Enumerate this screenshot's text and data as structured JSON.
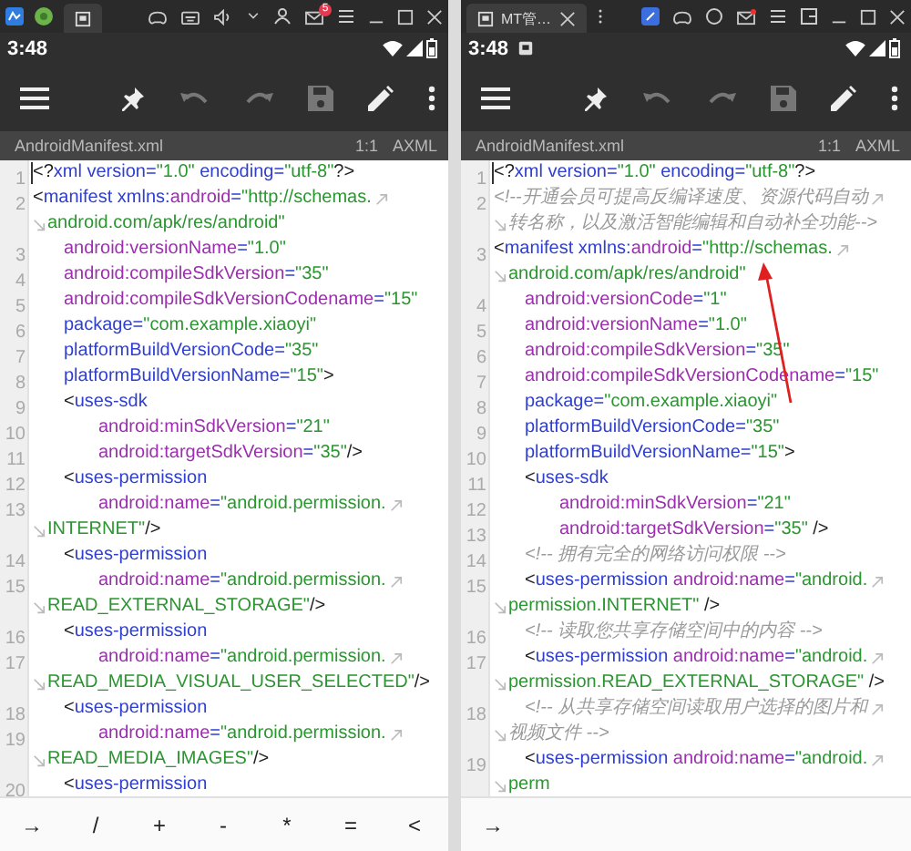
{
  "panels": [
    {
      "host_bar": {
        "badge": "5"
      },
      "status_bar": {
        "time": "3:48"
      },
      "file_bar": {
        "file_name": "AndroidManifest.xml",
        "position": "1:1",
        "mode": "AXML"
      },
      "code_lines": [
        {
          "number": "1",
          "kind": "root",
          "tokens": [
            {
              "kind": "punct",
              "text": "<?"
            },
            {
              "kind": "tag",
              "text": "xml"
            },
            {
              "kind": "attr",
              "text": " version="
            },
            {
              "kind": "value",
              "text": "\"1.0\""
            },
            {
              "kind": "attr",
              "text": " encoding="
            },
            {
              "kind": "value",
              "text": "\"utf-8\""
            },
            {
              "kind": "punct",
              "text": "?>"
            }
          ]
        },
        {
          "number": "2",
          "kind": "root",
          "wrapped": true,
          "tokens": [
            {
              "kind": "punct",
              "text": "<"
            },
            {
              "kind": "tag",
              "text": "manifest"
            },
            {
              "kind": "attr",
              "text": " xmlns:"
            },
            {
              "kind": "ns",
              "text": "android"
            },
            {
              "kind": "attr",
              "text": "="
            },
            {
              "kind": "value",
              "text": "\"http://schemas."
            }
          ]
        },
        {
          "kind": "wrap",
          "tokens": [
            {
              "kind": "value",
              "text": "android.com/apk/res/android\""
            }
          ]
        },
        {
          "number": "3",
          "kind": "inner",
          "tokens": [
            {
              "kind": "ns",
              "text": "android:versionName"
            },
            {
              "kind": "attr",
              "text": "="
            },
            {
              "kind": "value",
              "text": "\"1.0\""
            }
          ]
        },
        {
          "number": "4",
          "kind": "inner",
          "tokens": [
            {
              "kind": "ns",
              "text": "android:compileSdkVersion"
            },
            {
              "kind": "attr",
              "text": "="
            },
            {
              "kind": "value",
              "text": "\"35\""
            }
          ]
        },
        {
          "number": "5",
          "kind": "inner",
          "tokens": [
            {
              "kind": "ns",
              "text": "android:compileSdkVersionCodename"
            },
            {
              "kind": "attr",
              "text": "="
            },
            {
              "kind": "value",
              "text": "\"15\""
            }
          ]
        },
        {
          "number": "6",
          "kind": "inner",
          "tokens": [
            {
              "kind": "attr",
              "text": "package="
            },
            {
              "kind": "value",
              "text": "\"com.example.xiaoyi\""
            }
          ]
        },
        {
          "number": "7",
          "kind": "inner",
          "tokens": [
            {
              "kind": "attr",
              "text": "platformBuildVersionCode="
            },
            {
              "kind": "value",
              "text": "\"35\""
            }
          ]
        },
        {
          "number": "8",
          "kind": "inner",
          "tokens": [
            {
              "kind": "attr",
              "text": "platformBuildVersionName="
            },
            {
              "kind": "value",
              "text": "\"15\""
            },
            {
              "kind": "punct",
              "text": ">"
            }
          ]
        },
        {
          "number": "9",
          "kind": "inner",
          "tokens": [
            {
              "kind": "punct",
              "text": "<"
            },
            {
              "kind": "tag",
              "text": "uses-sdk"
            }
          ]
        },
        {
          "number": "10",
          "kind": "deep",
          "tokens": [
            {
              "kind": "ns",
              "text": "android:minSdkVersion"
            },
            {
              "kind": "attr",
              "text": "="
            },
            {
              "kind": "value",
              "text": "\"21\""
            }
          ]
        },
        {
          "number": "11",
          "kind": "deep",
          "tokens": [
            {
              "kind": "ns",
              "text": "android:targetSdkVersion"
            },
            {
              "kind": "attr",
              "text": "="
            },
            {
              "kind": "value",
              "text": "\"35\""
            },
            {
              "kind": "punct",
              "text": "/>"
            }
          ]
        },
        {
          "number": "12",
          "kind": "inner",
          "tokens": [
            {
              "kind": "punct",
              "text": "<"
            },
            {
              "kind": "tag",
              "text": "uses-permission"
            }
          ]
        },
        {
          "number": "13",
          "kind": "deep",
          "wrapped": true,
          "tokens": [
            {
              "kind": "ns",
              "text": "android:name"
            },
            {
              "kind": "attr",
              "text": "="
            },
            {
              "kind": "value",
              "text": "\"android.permission."
            }
          ]
        },
        {
          "kind": "wrap",
          "tokens": [
            {
              "kind": "value",
              "text": "INTERNET\""
            },
            {
              "kind": "punct",
              "text": "/>"
            }
          ]
        },
        {
          "number": "14",
          "kind": "inner",
          "tokens": [
            {
              "kind": "punct",
              "text": "<"
            },
            {
              "kind": "tag",
              "text": "uses-permission"
            }
          ]
        },
        {
          "number": "15",
          "kind": "deep",
          "wrapped": true,
          "tokens": [
            {
              "kind": "ns",
              "text": "android:name"
            },
            {
              "kind": "attr",
              "text": "="
            },
            {
              "kind": "value",
              "text": "\"android.permission."
            }
          ]
        },
        {
          "kind": "wrap",
          "tokens": [
            {
              "kind": "value",
              "text": "READ_EXTERNAL_STORAGE\""
            },
            {
              "kind": "punct",
              "text": "/>"
            }
          ]
        },
        {
          "number": "16",
          "kind": "inner",
          "tokens": [
            {
              "kind": "punct",
              "text": "<"
            },
            {
              "kind": "tag",
              "text": "uses-permission"
            }
          ]
        },
        {
          "number": "17",
          "kind": "deep",
          "wrapped": true,
          "tokens": [
            {
              "kind": "ns",
              "text": "android:name"
            },
            {
              "kind": "attr",
              "text": "="
            },
            {
              "kind": "value",
              "text": "\"android.permission."
            }
          ]
        },
        {
          "kind": "wrap",
          "tokens": [
            {
              "kind": "value",
              "text": "READ_MEDIA_VISUAL_USER_SELECTED\""
            },
            {
              "kind": "punct",
              "text": "/>"
            }
          ]
        },
        {
          "number": "18",
          "kind": "inner",
          "tokens": [
            {
              "kind": "punct",
              "text": "<"
            },
            {
              "kind": "tag",
              "text": "uses-permission"
            }
          ]
        },
        {
          "number": "19",
          "kind": "deep",
          "wrapped": true,
          "tokens": [
            {
              "kind": "ns",
              "text": "android:name"
            },
            {
              "kind": "attr",
              "text": "="
            },
            {
              "kind": "value",
              "text": "\"android.permission."
            }
          ]
        },
        {
          "kind": "wrap",
          "tokens": [
            {
              "kind": "value",
              "text": "READ_MEDIA_IMAGES\""
            },
            {
              "kind": "punct",
              "text": "/>"
            }
          ]
        },
        {
          "number": "20",
          "kind": "inner",
          "tokens": [
            {
              "kind": "punct",
              "text": "<"
            },
            {
              "kind": "tag",
              "text": "uses-permission"
            }
          ]
        }
      ],
      "keys": [
        "→",
        "/",
        "+",
        "-",
        "*",
        "=",
        "<"
      ]
    },
    {
      "host_bar": {
        "tab_title": "MT管…"
      },
      "status_bar": {
        "time": "3:48"
      },
      "file_bar": {
        "file_name": "AndroidManifest.xml",
        "position": "1:1",
        "mode": "AXML"
      },
      "code_lines": [
        {
          "number": "1",
          "kind": "root",
          "tokens": [
            {
              "kind": "punct",
              "text": "<?"
            },
            {
              "kind": "tag",
              "text": "xml"
            },
            {
              "kind": "attr",
              "text": " version="
            },
            {
              "kind": "value",
              "text": "\"1.0\""
            },
            {
              "kind": "attr",
              "text": " encoding="
            },
            {
              "kind": "value",
              "text": "\"utf-8\""
            },
            {
              "kind": "punct",
              "text": "?>"
            }
          ]
        },
        {
          "number": "2",
          "kind": "root",
          "wrapped": true,
          "tokens": [
            {
              "kind": "comment",
              "text": "<!--开通会员可提高反编译速度、资源代码自动"
            }
          ]
        },
        {
          "kind": "wrap",
          "tokens": [
            {
              "kind": "comment",
              "text": "转名称，以及激活智能编辑和自动补全功能-->"
            }
          ]
        },
        {
          "number": "3",
          "kind": "root",
          "wrapped": true,
          "tokens": [
            {
              "kind": "punct",
              "text": "<"
            },
            {
              "kind": "tag",
              "text": "manifest"
            },
            {
              "kind": "attr",
              "text": " xmlns:"
            },
            {
              "kind": "ns",
              "text": "android"
            },
            {
              "kind": "attr",
              "text": "="
            },
            {
              "kind": "value",
              "text": "\"http://schemas."
            }
          ]
        },
        {
          "kind": "wrap",
          "tokens": [
            {
              "kind": "value",
              "text": "android.com/apk/res/android\""
            }
          ]
        },
        {
          "number": "4",
          "kind": "inner",
          "tokens": [
            {
              "kind": "ns",
              "text": "android:versionCode"
            },
            {
              "kind": "attr",
              "text": "="
            },
            {
              "kind": "value",
              "text": "\"1\""
            }
          ]
        },
        {
          "number": "5",
          "kind": "inner",
          "tokens": [
            {
              "kind": "ns",
              "text": "android:versionName"
            },
            {
              "kind": "attr",
              "text": "="
            },
            {
              "kind": "value",
              "text": "\"1.0\""
            }
          ]
        },
        {
          "number": "6",
          "kind": "inner",
          "tokens": [
            {
              "kind": "ns",
              "text": "android:compileSdkVersion"
            },
            {
              "kind": "attr",
              "text": "="
            },
            {
              "kind": "value",
              "text": "\"35\""
            }
          ]
        },
        {
          "number": "7",
          "kind": "inner",
          "tokens": [
            {
              "kind": "ns",
              "text": "android:compileSdkVersionCodename"
            },
            {
              "kind": "attr",
              "text": "="
            },
            {
              "kind": "value",
              "text": "\"15\""
            }
          ]
        },
        {
          "number": "8",
          "kind": "inner",
          "tokens": [
            {
              "kind": "attr",
              "text": "package="
            },
            {
              "kind": "value",
              "text": "\"com.example.xiaoyi\""
            }
          ]
        },
        {
          "number": "9",
          "kind": "inner",
          "tokens": [
            {
              "kind": "attr",
              "text": "platformBuildVersionCode="
            },
            {
              "kind": "value",
              "text": "\"35\""
            }
          ]
        },
        {
          "number": "10",
          "kind": "inner",
          "tokens": [
            {
              "kind": "attr",
              "text": "platformBuildVersionName="
            },
            {
              "kind": "value",
              "text": "\"15\""
            },
            {
              "kind": "punct",
              "text": ">"
            }
          ]
        },
        {
          "number": "11",
          "kind": "inner",
          "tokens": [
            {
              "kind": "punct",
              "text": "<"
            },
            {
              "kind": "tag",
              "text": "uses-sdk"
            }
          ]
        },
        {
          "number": "12",
          "kind": "deep",
          "tokens": [
            {
              "kind": "ns",
              "text": "android:minSdkVersion"
            },
            {
              "kind": "attr",
              "text": "="
            },
            {
              "kind": "value",
              "text": "\"21\""
            }
          ]
        },
        {
          "number": "13",
          "kind": "deep",
          "tokens": [
            {
              "kind": "ns",
              "text": "android:targetSdkVersion"
            },
            {
              "kind": "attr",
              "text": "="
            },
            {
              "kind": "value",
              "text": "\"35\""
            },
            {
              "kind": "punct",
              "text": " />"
            }
          ]
        },
        {
          "number": "14",
          "kind": "inner",
          "tokens": [
            {
              "kind": "comment",
              "text": "<!-- 拥有完全的网络访问权限 -->"
            }
          ]
        },
        {
          "number": "15",
          "kind": "inner",
          "wrapped": true,
          "tokens": [
            {
              "kind": "punct",
              "text": "<"
            },
            {
              "kind": "tag",
              "text": "uses-permission"
            },
            {
              "kind": "ns",
              "text": " android:name"
            },
            {
              "kind": "attr",
              "text": "="
            },
            {
              "kind": "value",
              "text": "\"android."
            }
          ]
        },
        {
          "kind": "wrap",
          "tokens": [
            {
              "kind": "value",
              "text": "permission.INTERNET\""
            },
            {
              "kind": "punct",
              "text": " />"
            }
          ]
        },
        {
          "number": "16",
          "kind": "inner",
          "tokens": [
            {
              "kind": "comment",
              "text": "<!-- 读取您共享存储空间中的内容 -->"
            }
          ]
        },
        {
          "number": "17",
          "kind": "inner",
          "wrapped": true,
          "tokens": [
            {
              "kind": "punct",
              "text": "<"
            },
            {
              "kind": "tag",
              "text": "uses-permission"
            },
            {
              "kind": "ns",
              "text": " android:name"
            },
            {
              "kind": "attr",
              "text": "="
            },
            {
              "kind": "value",
              "text": "\"android."
            }
          ]
        },
        {
          "kind": "wrap",
          "tokens": [
            {
              "kind": "value",
              "text": "permission.READ_EXTERNAL_STORAGE\""
            },
            {
              "kind": "punct",
              "text": " />"
            }
          ]
        },
        {
          "number": "18",
          "kind": "inner",
          "wrapped": true,
          "tokens": [
            {
              "kind": "comment",
              "text": "<!-- 从共享存储空间读取用户选择的图片和"
            }
          ]
        },
        {
          "kind": "wrap",
          "tokens": [
            {
              "kind": "comment",
              "text": "视频文件 -->"
            }
          ]
        },
        {
          "number": "19",
          "kind": "inner",
          "wrapped": true,
          "tokens": [
            {
              "kind": "punct",
              "text": "<"
            },
            {
              "kind": "tag",
              "text": "uses-permission"
            },
            {
              "kind": "ns",
              "text": " android:name"
            },
            {
              "kind": "attr",
              "text": "="
            },
            {
              "kind": "value",
              "text": "\"android."
            }
          ]
        },
        {
          "kind": "wrap",
          "tokens": [
            {
              "kind": "value",
              "text": "perm"
            }
          ]
        }
      ],
      "keys": [
        "→"
      ],
      "annotation": {
        "kind": "arrow"
      }
    }
  ]
}
